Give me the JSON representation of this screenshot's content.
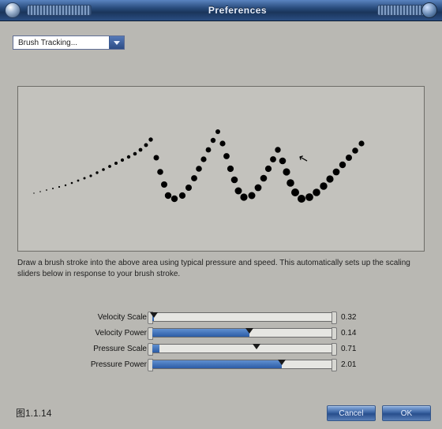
{
  "window": {
    "title": "Preferences"
  },
  "dropdown": {
    "selected": "Brush Tracking..."
  },
  "instructions": "Draw a brush stroke into the above area using typical pressure and speed.  This automatically sets up the scaling sliders below in response to your brush stroke.",
  "sliders": [
    {
      "label": "Velocity Scale",
      "value": "0.32",
      "fill_pct": 1,
      "thumb_pct": 1
    },
    {
      "label": "Velocity Power",
      "value": "0.14",
      "fill_pct": 54,
      "thumb_pct": 54
    },
    {
      "label": "Pressure Scale",
      "value": "0.71",
      "fill_pct": 4,
      "thumb_pct": 58
    },
    {
      "label": "Pressure Power",
      "value": "2.01",
      "fill_pct": 72,
      "thumb_pct": 72
    }
  ],
  "buttons": {
    "cancel": "Cancel",
    "ok": "OK"
  },
  "caption": "图1.1.14"
}
